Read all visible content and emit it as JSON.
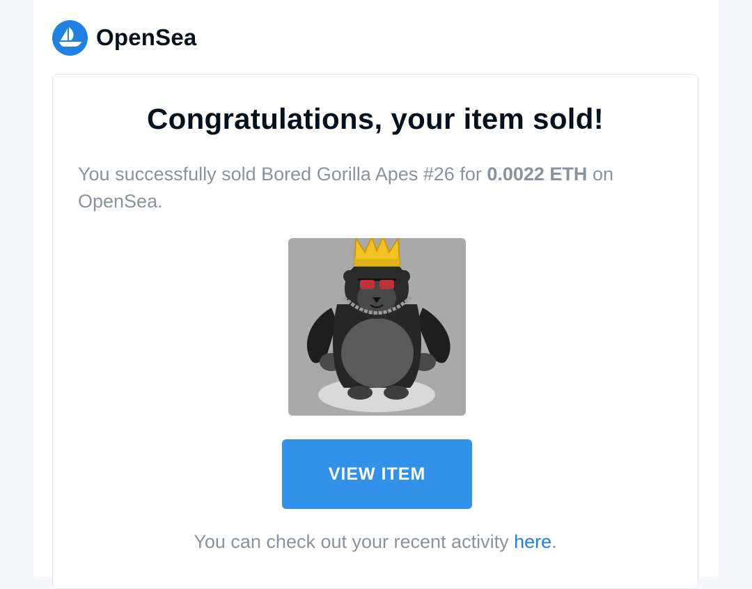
{
  "brand": {
    "name": "OpenSea",
    "logo_icon": "opensea-boat-icon",
    "color": "#2081e2"
  },
  "email": {
    "title": "Congratulations, your item sold!",
    "message": {
      "prefix": "You successfully sold Bored Gorilla Apes #26 for ",
      "price": "0.0022 ETH",
      "suffix": " on OpenSea."
    },
    "item_image": {
      "icon": "gorilla-nft-image",
      "alt": "Bored Gorilla Apes #26"
    },
    "button": {
      "label": "VIEW ITEM",
      "color": "#3291e9"
    },
    "footer": {
      "text": "You can check out your recent activity ",
      "link_text": "here",
      "end": ".",
      "link_color": "#2081e2"
    }
  }
}
